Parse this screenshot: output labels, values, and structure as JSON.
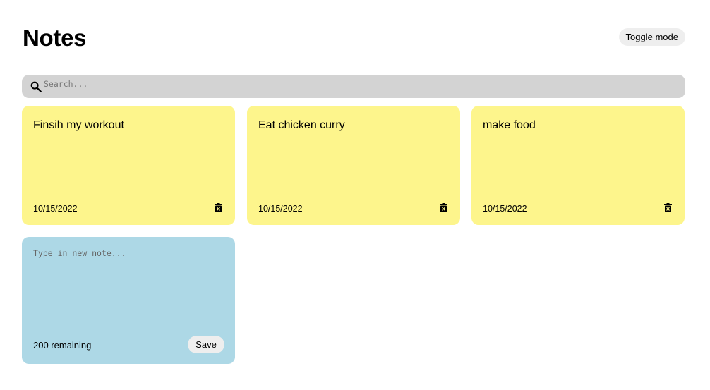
{
  "header": {
    "title": "Notes",
    "toggle_label": "Toggle mode"
  },
  "search": {
    "placeholder": "Search...",
    "value": "",
    "icon": "search-icon"
  },
  "notes": [
    {
      "text": "Finsih my workout",
      "date": "10/15/2022",
      "delete_icon": "trash-icon"
    },
    {
      "text": "Eat chicken curry",
      "date": "10/15/2022",
      "delete_icon": "trash-icon"
    },
    {
      "text": "make food",
      "date": "10/15/2022",
      "delete_icon": "trash-icon"
    }
  ],
  "new_note": {
    "placeholder": "Type in new note...",
    "value": "",
    "remaining": "200 remaining",
    "save_label": "Save"
  },
  "colors": {
    "note_background": "#fdf58c",
    "new_note_background": "#add8e6",
    "search_background": "#d3d3d3",
    "button_background": "#eeeeee"
  }
}
